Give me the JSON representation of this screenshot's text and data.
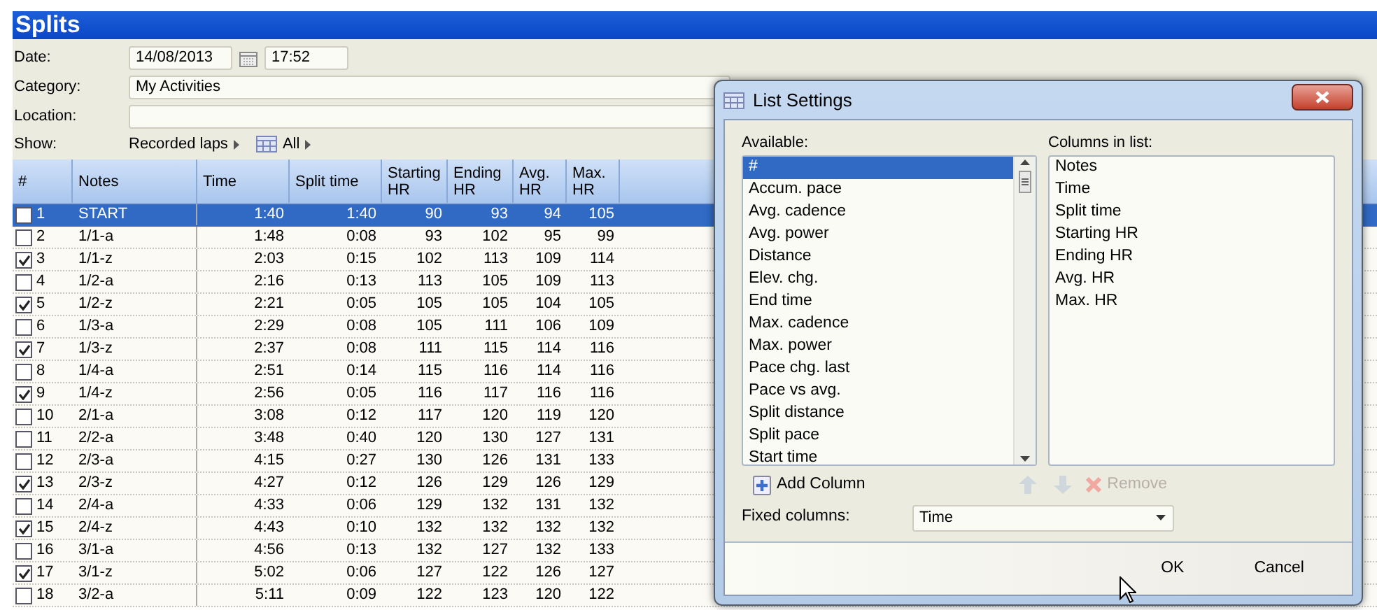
{
  "panel": {
    "title": "Splits"
  },
  "form": {
    "date_label": "Date:",
    "date": "14/08/2013",
    "time": "17:52",
    "category_label": "Category:",
    "category": "My Activities",
    "location_label": "Location:",
    "show_label": "Show:",
    "show_laps": "Recorded laps",
    "show_all": "All"
  },
  "table": {
    "columns": [
      "#",
      "Notes",
      "Time",
      "Split time",
      "Starting HR",
      "Ending HR",
      "Avg. HR",
      "Max. HR"
    ],
    "rows": [
      {
        "number": "1",
        "notes": "START",
        "time": "1:40",
        "split": "1:40",
        "start_hr": "90",
        "end_hr": "93",
        "avg_hr": "94",
        "max_hr": "105",
        "checked": false,
        "selected": true
      },
      {
        "number": "2",
        "notes": "1/1-a",
        "time": "1:48",
        "split": "0:08",
        "start_hr": "93",
        "end_hr": "102",
        "avg_hr": "95",
        "max_hr": "99",
        "checked": false,
        "selected": false
      },
      {
        "number": "3",
        "notes": "1/1-z",
        "time": "2:03",
        "split": "0:15",
        "start_hr": "102",
        "end_hr": "113",
        "avg_hr": "109",
        "max_hr": "114",
        "checked": true,
        "selected": false
      },
      {
        "number": "4",
        "notes": "1/2-a",
        "time": "2:16",
        "split": "0:13",
        "start_hr": "113",
        "end_hr": "105",
        "avg_hr": "109",
        "max_hr": "113",
        "checked": false,
        "selected": false
      },
      {
        "number": "5",
        "notes": "1/2-z",
        "time": "2:21",
        "split": "0:05",
        "start_hr": "105",
        "end_hr": "105",
        "avg_hr": "104",
        "max_hr": "105",
        "checked": true,
        "selected": false
      },
      {
        "number": "6",
        "notes": "1/3-a",
        "time": "2:29",
        "split": "0:08",
        "start_hr": "105",
        "end_hr": "111",
        "avg_hr": "106",
        "max_hr": "109",
        "checked": false,
        "selected": false
      },
      {
        "number": "7",
        "notes": "1/3-z",
        "time": "2:37",
        "split": "0:08",
        "start_hr": "111",
        "end_hr": "115",
        "avg_hr": "114",
        "max_hr": "116",
        "checked": true,
        "selected": false
      },
      {
        "number": "8",
        "notes": "1/4-a",
        "time": "2:51",
        "split": "0:14",
        "start_hr": "115",
        "end_hr": "116",
        "avg_hr": "114",
        "max_hr": "116",
        "checked": false,
        "selected": false
      },
      {
        "number": "9",
        "notes": "1/4-z",
        "time": "2:56",
        "split": "0:05",
        "start_hr": "116",
        "end_hr": "117",
        "avg_hr": "116",
        "max_hr": "116",
        "checked": true,
        "selected": false
      },
      {
        "number": "10",
        "notes": "2/1-a",
        "time": "3:08",
        "split": "0:12",
        "start_hr": "117",
        "end_hr": "120",
        "avg_hr": "119",
        "max_hr": "120",
        "checked": false,
        "selected": false
      },
      {
        "number": "11",
        "notes": "2/2-a",
        "time": "3:48",
        "split": "0:40",
        "start_hr": "120",
        "end_hr": "130",
        "avg_hr": "127",
        "max_hr": "131",
        "checked": false,
        "selected": false
      },
      {
        "number": "12",
        "notes": "2/3-a",
        "time": "4:15",
        "split": "0:27",
        "start_hr": "130",
        "end_hr": "126",
        "avg_hr": "131",
        "max_hr": "133",
        "checked": false,
        "selected": false
      },
      {
        "number": "13",
        "notes": "2/3-z",
        "time": "4:27",
        "split": "0:12",
        "start_hr": "126",
        "end_hr": "129",
        "avg_hr": "126",
        "max_hr": "129",
        "checked": true,
        "selected": false
      },
      {
        "number": "14",
        "notes": "2/4-a",
        "time": "4:33",
        "split": "0:06",
        "start_hr": "129",
        "end_hr": "132",
        "avg_hr": "131",
        "max_hr": "132",
        "checked": false,
        "selected": false
      },
      {
        "number": "15",
        "notes": "2/4-z",
        "time": "4:43",
        "split": "0:10",
        "start_hr": "132",
        "end_hr": "132",
        "avg_hr": "132",
        "max_hr": "132",
        "checked": true,
        "selected": false
      },
      {
        "number": "16",
        "notes": "3/1-a",
        "time": "4:56",
        "split": "0:13",
        "start_hr": "132",
        "end_hr": "127",
        "avg_hr": "132",
        "max_hr": "133",
        "checked": false,
        "selected": false
      },
      {
        "number": "17",
        "notes": "3/1-z",
        "time": "5:02",
        "split": "0:06",
        "start_hr": "127",
        "end_hr": "122",
        "avg_hr": "126",
        "max_hr": "127",
        "checked": true,
        "selected": false
      },
      {
        "number": "18",
        "notes": "3/2-a",
        "time": "5:11",
        "split": "0:09",
        "start_hr": "122",
        "end_hr": "123",
        "avg_hr": "120",
        "max_hr": "122",
        "checked": false,
        "selected": false
      }
    ]
  },
  "dialog": {
    "title": "List Settings",
    "available_label": "Available:",
    "available": [
      {
        "label": "#",
        "selected": true
      },
      {
        "label": "Accum. pace",
        "selected": false
      },
      {
        "label": "Avg. cadence",
        "selected": false
      },
      {
        "label": "Avg. power",
        "selected": false
      },
      {
        "label": "Distance",
        "selected": false
      },
      {
        "label": "Elev. chg.",
        "selected": false
      },
      {
        "label": "End time",
        "selected": false
      },
      {
        "label": "Max. cadence",
        "selected": false
      },
      {
        "label": "Max. power",
        "selected": false
      },
      {
        "label": "Pace chg. last",
        "selected": false
      },
      {
        "label": "Pace vs avg.",
        "selected": false
      },
      {
        "label": "Split distance",
        "selected": false
      },
      {
        "label": "Split pace",
        "selected": false
      },
      {
        "label": "Start time",
        "selected": false
      }
    ],
    "columns_label": "Columns in list:",
    "columns": [
      "Notes",
      "Time",
      "Split time",
      "Starting HR",
      "Ending HR",
      "Avg. HR",
      "Max. HR"
    ],
    "add_column": "Add Column",
    "remove": "Remove",
    "remove_disabled": true,
    "fixed_label": "Fixed columns:",
    "fixed_value": "Time",
    "buttons": [
      "OK",
      "Cancel"
    ]
  }
}
